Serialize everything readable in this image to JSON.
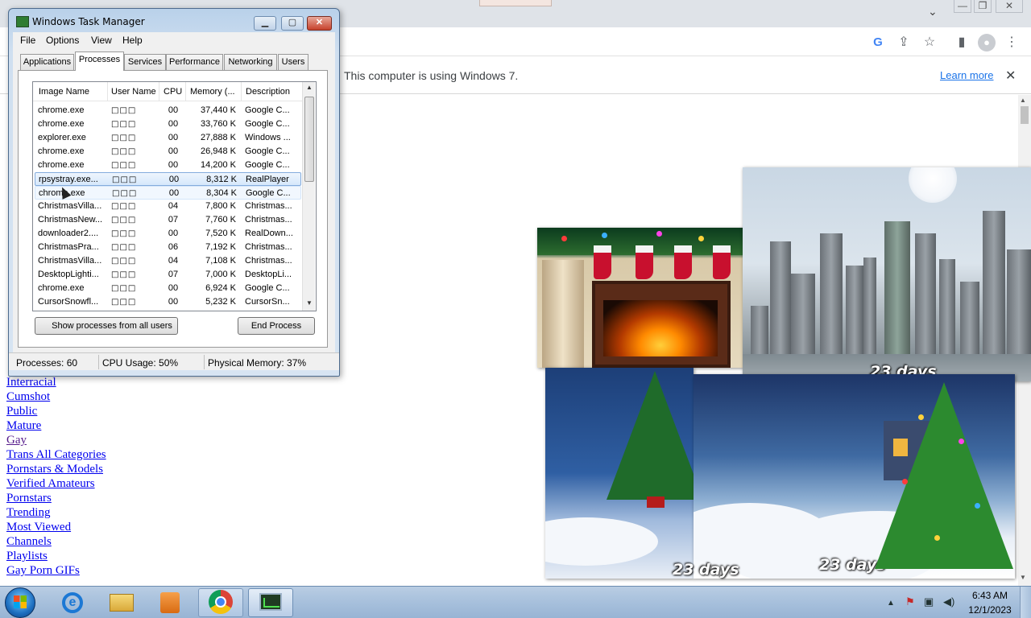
{
  "browser": {
    "infobar_text": "This computer is using Windows 7.",
    "learn_more": "Learn more",
    "close_glyph": "✕",
    "tab_menu_glyph": "⌄",
    "window_min": "—",
    "window_restore": "❐",
    "window_close": "✕",
    "toolbar_icons": {
      "google": "G",
      "share": "⇪",
      "star": "☆",
      "side_panel": "▮",
      "profile": "●",
      "menu": "⋮"
    }
  },
  "page_links": [
    {
      "label": "Interracial",
      "visited": false
    },
    {
      "label": "Cumshot",
      "visited": false
    },
    {
      "label": "Public",
      "visited": false
    },
    {
      "label": "Mature",
      "visited": false
    },
    {
      "label": "Gay",
      "visited": true
    },
    {
      "label": "Trans All Categories",
      "visited": false
    },
    {
      "label": "Pornstars & Models",
      "visited": false
    },
    {
      "label": "Verified Amateurs",
      "visited": false
    },
    {
      "label": "Pornstars",
      "visited": false
    },
    {
      "label": "Trending",
      "visited": false
    },
    {
      "label": "Most Viewed",
      "visited": false
    },
    {
      "label": "Channels",
      "visited": false
    },
    {
      "label": "Playlists",
      "visited": false
    },
    {
      "label": "Gay Porn GIFs",
      "visited": false
    }
  ],
  "gadgets": {
    "city_days": "23 days",
    "tree_days": "23 days",
    "village_days": "23 days"
  },
  "task_manager": {
    "title": "Windows Task Manager",
    "controls": {
      "minimize": "▁",
      "maximize": "▢",
      "close": "✕"
    },
    "menu": {
      "file": "File",
      "options": "Options",
      "view": "View",
      "help": "Help"
    },
    "tabs": {
      "applications": "Applications",
      "processes": "Processes",
      "services": "Services",
      "performance": "Performance",
      "networking": "Networking",
      "users": "Users"
    },
    "active_tab": "Processes",
    "columns": {
      "image_name": "Image Name",
      "user_name": "User Name",
      "cpu": "CPU",
      "memory": "Memory (...",
      "description": "Description"
    },
    "rows": [
      {
        "name": "chrome.exe",
        "user": "□□□",
        "cpu": "00",
        "memory": "37,440 K",
        "desc": "Google C..."
      },
      {
        "name": "chrome.exe",
        "user": "□□□",
        "cpu": "00",
        "memory": "33,760 K",
        "desc": "Google C..."
      },
      {
        "name": "explorer.exe",
        "user": "□□□",
        "cpu": "00",
        "memory": "27,888 K",
        "desc": "Windows ..."
      },
      {
        "name": "chrome.exe",
        "user": "□□□",
        "cpu": "00",
        "memory": "26,948 K",
        "desc": "Google C..."
      },
      {
        "name": "chrome.exe",
        "user": "□□□",
        "cpu": "00",
        "memory": "14,200 K",
        "desc": "Google C..."
      },
      {
        "name": "rpsystray.exe...",
        "user": "□□□",
        "cpu": "00",
        "memory": "8,312 K",
        "desc": "RealPlayer"
      },
      {
        "name": "chrome.exe",
        "user": "□□□",
        "cpu": "00",
        "memory": "8,304 K",
        "desc": "Google C..."
      },
      {
        "name": "ChristmasVilla...",
        "user": "□□□",
        "cpu": "04",
        "memory": "7,800 K",
        "desc": "Christmas..."
      },
      {
        "name": "ChristmasNew...",
        "user": "□□□",
        "cpu": "07",
        "memory": "7,760 K",
        "desc": "Christmas..."
      },
      {
        "name": "downloader2....",
        "user": "□□□",
        "cpu": "00",
        "memory": "7,520 K",
        "desc": "RealDown..."
      },
      {
        "name": "ChristmasPra...",
        "user": "□□□",
        "cpu": "06",
        "memory": "7,192 K",
        "desc": "Christmas..."
      },
      {
        "name": "ChristmasVilla...",
        "user": "□□□",
        "cpu": "04",
        "memory": "7,108 K",
        "desc": "Christmas..."
      },
      {
        "name": "DesktopLighti...",
        "user": "□□□",
        "cpu": "07",
        "memory": "7,000 K",
        "desc": "DesktopLi..."
      },
      {
        "name": "chrome.exe",
        "user": "□□□",
        "cpu": "00",
        "memory": "6,924 K",
        "desc": "Google C..."
      },
      {
        "name": "CursorSnowfl...",
        "user": "□□□",
        "cpu": "00",
        "memory": "5,232 K",
        "desc": "CursorSn..."
      }
    ],
    "selected_row_index": 5,
    "hover_row_index": 6,
    "show_all_button": "Show processes from all users",
    "end_process_button": "End Process",
    "status": {
      "processes": "Processes: 60",
      "cpu": "CPU Usage: 50%",
      "memory": "Physical Memory: 37%"
    }
  },
  "taskbar": {
    "pinned": [
      "start",
      "internet-explorer",
      "windows-explorer",
      "media-player",
      "chrome",
      "task-manager"
    ],
    "active_app": "task-manager",
    "tray_icons": {
      "show_hidden": "▲",
      "action_center": "⚑",
      "network": "▣",
      "volume": "◀)"
    },
    "clock_time": "6:43 AM",
    "clock_date": "12/1/2023"
  },
  "colors": {
    "link": "#0000ee",
    "link_visited": "#551a8b",
    "learn_more": "#1a73e8",
    "taskbar": "#a7c0dc",
    "selection": "#d6e8fb"
  }
}
